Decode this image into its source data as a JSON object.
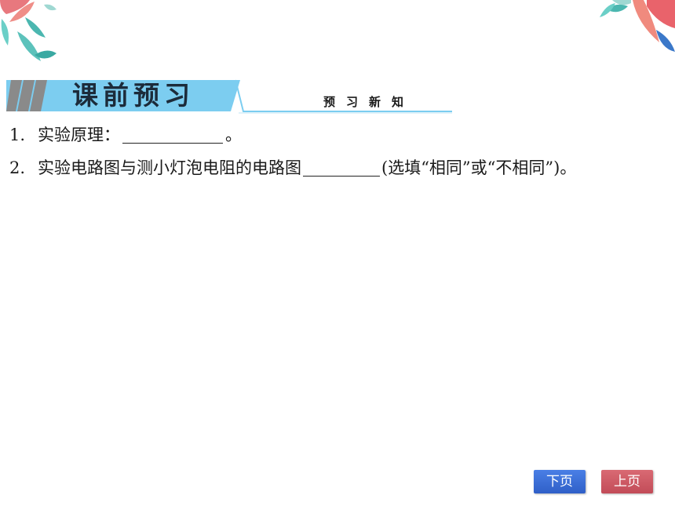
{
  "header": {
    "title": "课前预习",
    "subtitle": "预习新知",
    "accent_color": "#7ccdf0"
  },
  "questions": [
    {
      "number": "1.",
      "text_before": "实验原理：",
      "text_after": "。"
    },
    {
      "number": "2.",
      "text_before": "实验电路图与测小灯泡电阻的电路图",
      "text_after": "(选填“相同”或“不相同”)。"
    }
  ],
  "nav": {
    "next_label": "下页",
    "prev_label": "上页",
    "next_color": "#3a6fd8",
    "prev_color": "#cf5b66"
  }
}
